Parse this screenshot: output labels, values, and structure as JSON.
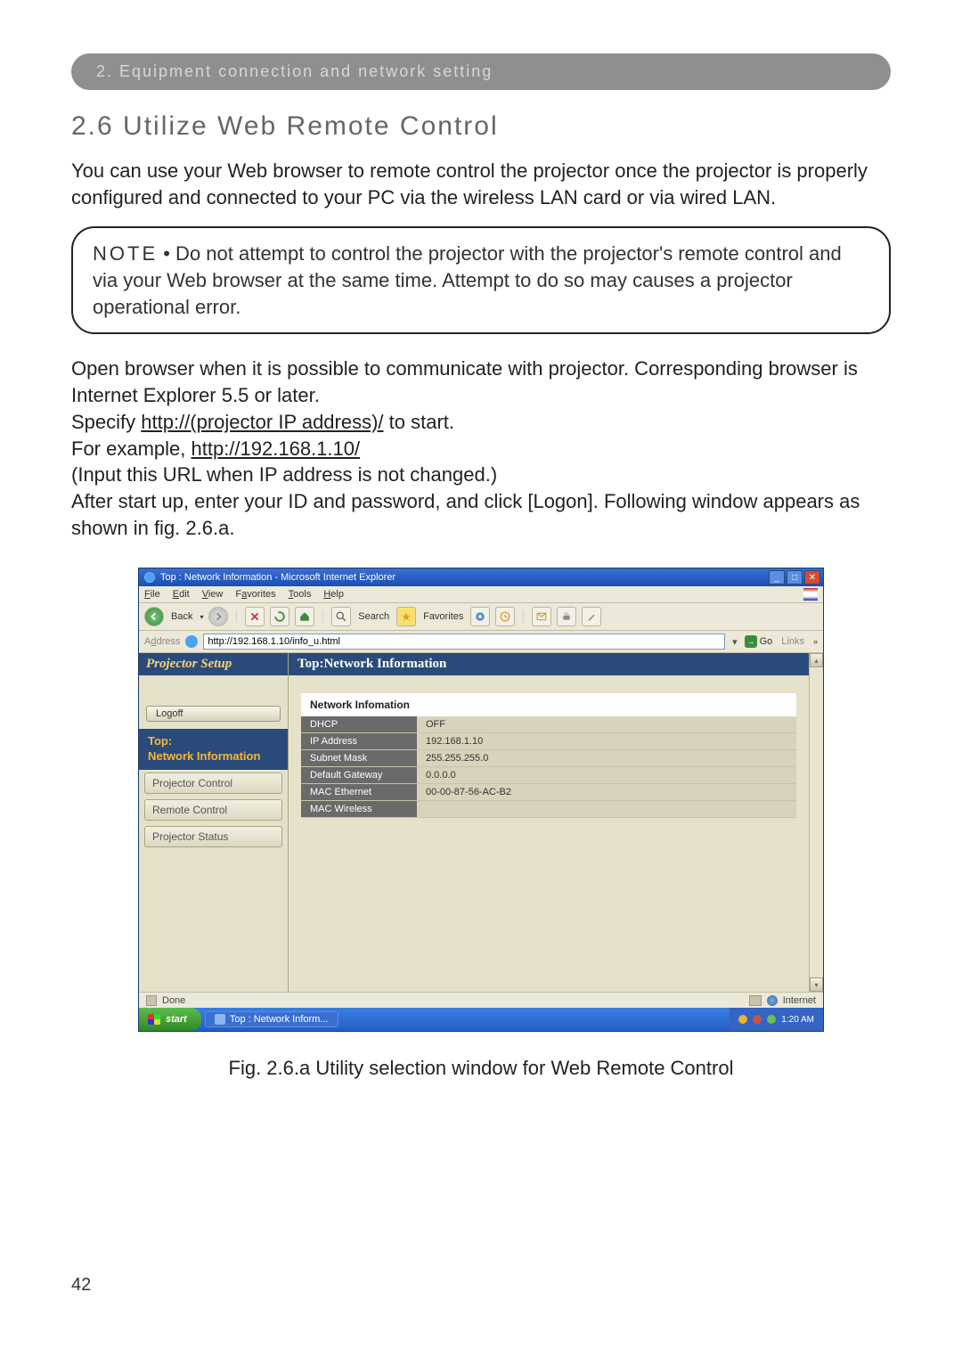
{
  "doc": {
    "section_bar": "2. Equipment connection and network setting",
    "heading": "2.6 Utilize Web Remote Control",
    "intro": "You can use your Web browser to remote control the projector once the projector is properly configured and connected to your PC via the wireless LAN card or via wired LAN.",
    "note_label": "NOTE",
    "note_body": " • Do not attempt to control the projector with the projector's remote control and via your Web browser at the same time. Attempt to do so may causes a projector operational error.",
    "p2a": "Open browser when it is possible to communicate with projector. Corresponding browser is Internet Explorer 5.5 or later.",
    "p2b_pre": "Specify ",
    "p2b_url": "http://(projector IP address)/",
    "p2b_post": " to start.",
    "p2c_pre": "For example, ",
    "p2c_url": "http://192.168.1.10/",
    "p2d": "(Input this URL when IP address is not changed.)",
    "p2e": "After start up, enter your ID and password, and click [Logon]. Following window appears as shown in fig. 2.6.a.",
    "fig_caption": "Fig. 2.6.a Utility selection window for Web Remote Control",
    "page_num": "42"
  },
  "ie": {
    "title": "Top : Network Information - Microsoft Internet Explorer",
    "menus": {
      "file": "File",
      "edit": "Edit",
      "view": "View",
      "favorites": "Favorites",
      "tools": "Tools",
      "help": "Help"
    },
    "toolbar": {
      "back": "Back",
      "search": "Search",
      "favorites": "Favorites"
    },
    "addr_label": "Address",
    "addr_value": "http://192.168.1.10/info_u.html",
    "go": "Go",
    "links": "Links",
    "status_done": "Done",
    "status_zone": "Internet"
  },
  "sidebar": {
    "brand": "Projector Setup",
    "logoff": "Logoff",
    "active_top": "Top:",
    "active_sub": "Network Information",
    "items": [
      "Projector Control",
      "Remote Control",
      "Projector Status"
    ]
  },
  "main": {
    "header": "Top:Network Information",
    "info_title": "Network Infomation",
    "rows": [
      {
        "k": "DHCP",
        "v": "OFF"
      },
      {
        "k": "IP Address",
        "v": "192.168.1.10"
      },
      {
        "k": "Subnet Mask",
        "v": "255.255.255.0"
      },
      {
        "k": "Default Gateway",
        "v": "0.0.0.0"
      },
      {
        "k": "MAC Ethernet",
        "v": "00-00-87-56-AC-B2"
      },
      {
        "k": "MAC Wireless",
        "v": ""
      }
    ]
  },
  "taskbar": {
    "start": "start",
    "task": "Top : Network Inform...",
    "time": "1:20 AM"
  }
}
